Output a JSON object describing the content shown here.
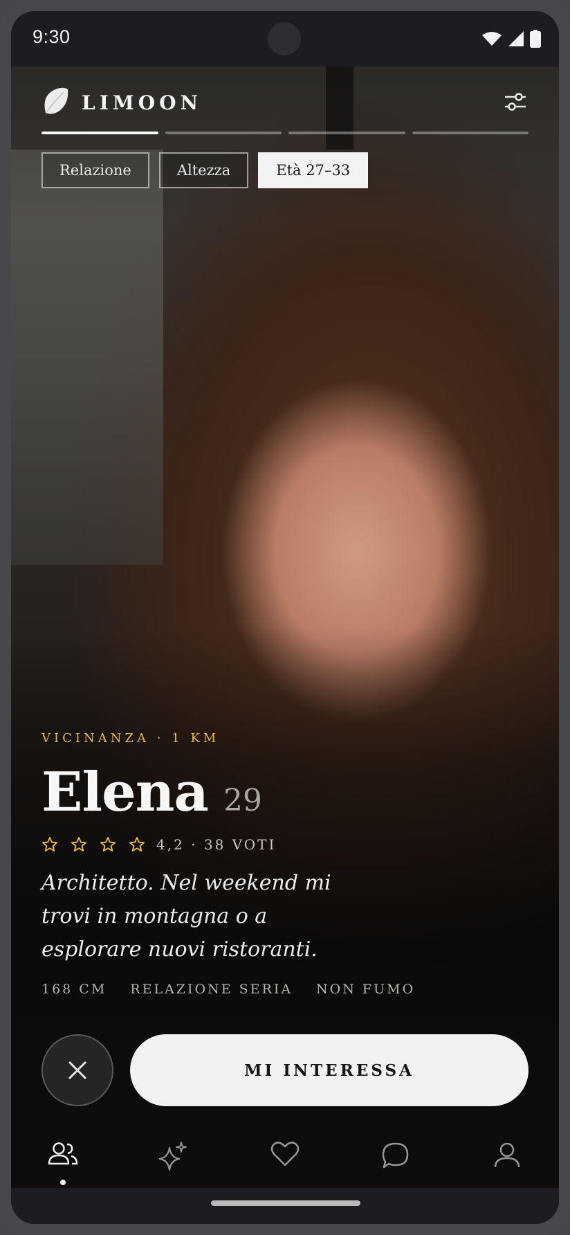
{
  "status_bar": {
    "time": "9:30"
  },
  "app": {
    "brand": "LIMOON"
  },
  "progress": {
    "segments": 4,
    "active_index": 0
  },
  "filters": [
    {
      "label": "Relazione",
      "active": false
    },
    {
      "label": "Altezza",
      "active": false
    },
    {
      "label": "Età 27–33",
      "active": true
    }
  ],
  "profile": {
    "proximity": "VICINANZA · 1 KM",
    "name": "Elena",
    "age": "29",
    "stars": 4,
    "rating_text": "4,2 · 38 VOTI",
    "bio": "Architetto. Nel weekend mi trovi in montagna o a esplorare nuovi ristoranti.",
    "tags": [
      "168 CM",
      "RELAZIONE SERIA",
      "NON FUMO"
    ]
  },
  "actions": {
    "interest_label": "MI INTERESSA"
  },
  "bottom_nav": {
    "items": [
      "people-icon",
      "sparkle-icon",
      "heart-icon",
      "chat-icon",
      "profile-icon"
    ],
    "active_index": 0
  },
  "colors": {
    "accent": "#e5b53a",
    "chip_active_bg": "#f3f3f3",
    "button_bg": "#f2f2f2"
  }
}
